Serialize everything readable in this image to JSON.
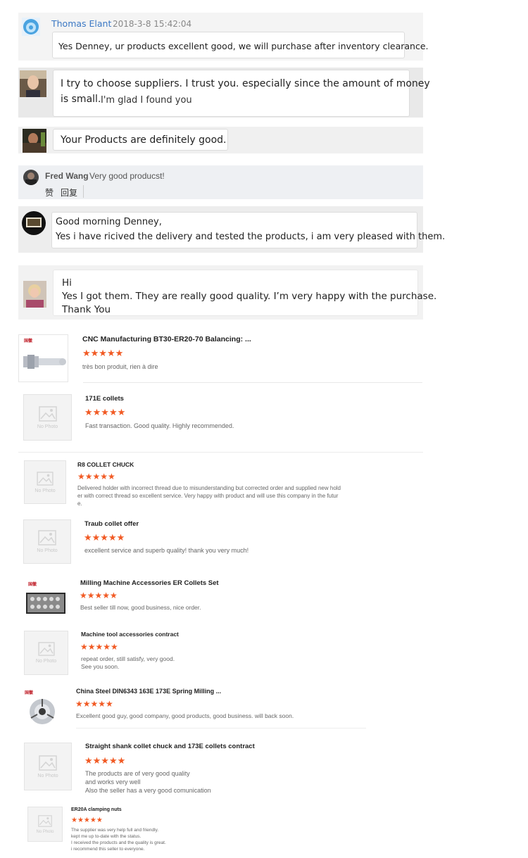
{
  "comments": [
    {
      "author": "Thomas Elant",
      "date": "2018-3-8 15:42:04",
      "text": "Yes Denney, ur products excellent good, we will purchase after inventory clearance."
    },
    {
      "text_a": "I try to choose suppliers. I trust you. especially since the amount of money",
      "text_b": "is small.",
      "text_c": "I'm glad I found you"
    },
    {
      "text": "Your Products are definitely good."
    },
    {
      "author": "Fred Wang",
      "text": "Very good producst!",
      "like": "赞",
      "reply": "回复"
    },
    {
      "line1": "Good morning Denney,",
      "line2": "Yes i have ricived the delivery and tested the products, i am very pleased with them."
    },
    {
      "line1": "Hi",
      "line2": "Yes I got them. They are really good quality. I’m very happy with the purchase.",
      "line3": "Thank You"
    }
  ],
  "no_photo_label": "No Photo",
  "stars": "★★★★★",
  "reviews": [
    {
      "title": "CNC Manufacturing BT30-ER20-70 Balancing: ...",
      "text": "très bon produit, rien à dire"
    },
    {
      "title": "171E collets",
      "text": "Fast transaction. Good quality. Highly recommended."
    },
    {
      "title": "R8 COLLET CHUCK",
      "text": "Delivered  holder with incorrect thread due to misunderstanding but corrected order and supplied new hold\ner with correct thread so excellent service. Very happy with product and will use this company in the futur\ne."
    },
    {
      "title": "Traub collet offer",
      "text": "excellent service and superb quality! thank you very much!"
    },
    {
      "title": "Milling Machine Accessories ER Collets Set",
      "text": "Best seller till now, good business, nice order."
    },
    {
      "title": "Machine tool accessories contract",
      "text": "repeat order, still satisfy, very good.\nSee you soon."
    },
    {
      "title": "China Steel DIN6343 163E 173E Spring Milling ...",
      "text": "Excellent good guy, good company, good products, good business. will back soon."
    },
    {
      "title": "Straight shank collet chuck and 173E collets contract",
      "text": "The products are of very good quality\nand works very well\nAlso the seller has a very good comunication"
    },
    {
      "title": "ER20A clamping nuts",
      "text": "The supplier was very help full and friendly.\nkept me up to-date with the status.\nI received the products and the quality is great.\ni recommend this seller to everyone."
    }
  ],
  "logo_text": "国徽",
  "colors": {
    "star": "#f15a24",
    "link": "#3b78c4",
    "panel": "#efefef"
  }
}
